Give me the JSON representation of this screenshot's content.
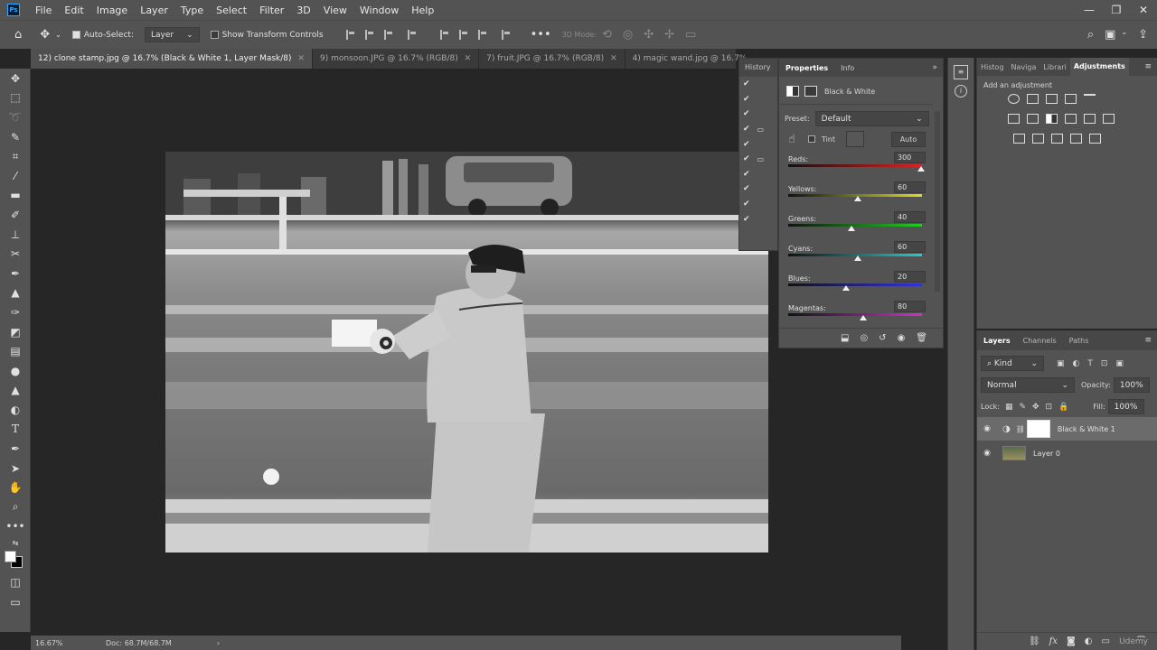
{
  "app": {
    "logo": "Ps"
  },
  "menus": [
    "File",
    "Edit",
    "Image",
    "Layer",
    "Type",
    "Select",
    "Filter",
    "3D",
    "View",
    "Window",
    "Help"
  ],
  "window_controls": {
    "minimize": "—",
    "restore": "❐",
    "close": "✕"
  },
  "options": {
    "auto_select_label": "Auto-Select:",
    "auto_select_value": "Layer",
    "transform_label": "Show Transform Controls",
    "mode_3d_label": "3D Mode:"
  },
  "tabs": [
    {
      "label": "12) clone stamp.jpg @ 16.7% (Black & White 1, Layer Mask/8)",
      "close": "✕",
      "active": true
    },
    {
      "label": "9) monsoon.JPG @ 16.7% (RGB/8)",
      "close": "✕",
      "active": false
    },
    {
      "label": "7) fruit.JPG @ 16.7% (RGB/8)",
      "close": "✕",
      "active": false
    },
    {
      "label": "4) magic wand.jpg @ 16.7%",
      "close": "",
      "active": false
    }
  ],
  "status": {
    "zoom": "16.67%",
    "doc": "Doc: 68.7M/68.7M",
    "arrow": "›"
  },
  "history": {
    "tab": "History"
  },
  "properties": {
    "tabs": [
      "Properties",
      "Info"
    ],
    "adjustment_name": "Black & White",
    "preset_label": "Preset:",
    "preset_value": "Default",
    "tint_label": "Tint",
    "auto_label": "Auto",
    "sliders": [
      {
        "label": "Reds:",
        "value": "300",
        "pos": 0.995
      },
      {
        "label": "Yellows:",
        "value": "60",
        "pos": 0.52
      },
      {
        "label": "Greens:",
        "value": "40",
        "pos": 0.47
      },
      {
        "label": "Cyans:",
        "value": "60",
        "pos": 0.52
      },
      {
        "label": "Blues:",
        "value": "20",
        "pos": 0.43
      },
      {
        "label": "Magentas:",
        "value": "80",
        "pos": 0.56
      }
    ]
  },
  "adjustments": {
    "tabs": [
      "Histog",
      "Naviga",
      "Librari",
      "Adjustments"
    ],
    "title": "Add an adjustment"
  },
  "layers": {
    "tabs": [
      "Layers",
      "Channels",
      "Paths"
    ],
    "filter_label": "Kind",
    "blend_mode": "Normal",
    "opacity_label": "Opacity:",
    "opacity_value": "100%",
    "lock_label": "Lock:",
    "fill_label": "Fill:",
    "fill_value": "100%",
    "items": [
      {
        "name": "Black & White 1",
        "selected": true
      },
      {
        "name": "Layer 0",
        "selected": false
      }
    ]
  },
  "watermark": "Udemy"
}
